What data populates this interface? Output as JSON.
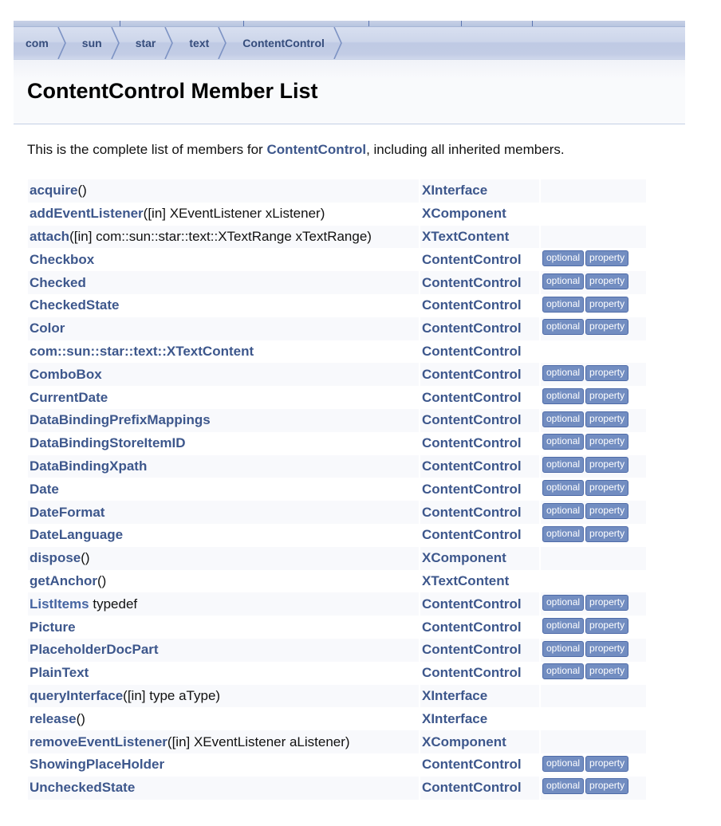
{
  "breadcrumb": [
    "com",
    "sun",
    "star",
    "text",
    "ContentControl"
  ],
  "header": {
    "title": "ContentControl Member List"
  },
  "intro": {
    "before": "This is the complete list of members for ",
    "link": "ContentControl",
    "after": ", including all inherited members."
  },
  "colors": {
    "link": "#3D578C",
    "badge_bg": "#728DC1",
    "stripe": "#F8F9FC"
  },
  "members": [
    {
      "name": "acquire",
      "args": "()",
      "scope": "XInterface",
      "badges": []
    },
    {
      "name": "addEventListener",
      "args": "([in] XEventListener xListener)",
      "scope": "XComponent",
      "badges": []
    },
    {
      "name": "attach",
      "args": "([in] com::sun::star::text::XTextRange xTextRange)",
      "scope": "XTextContent",
      "badges": []
    },
    {
      "name": "Checkbox",
      "args": "",
      "scope": "ContentControl",
      "badges": [
        "optional",
        "property"
      ]
    },
    {
      "name": "Checked",
      "args": "",
      "scope": "ContentControl",
      "badges": [
        "optional",
        "property"
      ]
    },
    {
      "name": "CheckedState",
      "args": "",
      "scope": "ContentControl",
      "badges": [
        "optional",
        "property"
      ]
    },
    {
      "name": "Color",
      "args": "",
      "scope": "ContentControl",
      "badges": [
        "optional",
        "property"
      ]
    },
    {
      "name": "com::sun::star::text::XTextContent",
      "args": "",
      "scope": "ContentControl",
      "badges": []
    },
    {
      "name": "ComboBox",
      "args": "",
      "scope": "ContentControl",
      "badges": [
        "optional",
        "property"
      ]
    },
    {
      "name": "CurrentDate",
      "args": "",
      "scope": "ContentControl",
      "badges": [
        "optional",
        "property"
      ]
    },
    {
      "name": "DataBindingPrefixMappings",
      "args": "",
      "scope": "ContentControl",
      "badges": [
        "optional",
        "property"
      ]
    },
    {
      "name": "DataBindingStoreItemID",
      "args": "",
      "scope": "ContentControl",
      "badges": [
        "optional",
        "property"
      ]
    },
    {
      "name": "DataBindingXpath",
      "args": "",
      "scope": "ContentControl",
      "badges": [
        "optional",
        "property"
      ]
    },
    {
      "name": "Date",
      "args": "",
      "scope": "ContentControl",
      "badges": [
        "optional",
        "property"
      ]
    },
    {
      "name": "DateFormat",
      "args": "",
      "scope": "ContentControl",
      "badges": [
        "optional",
        "property"
      ]
    },
    {
      "name": "DateLanguage",
      "args": "",
      "scope": "ContentControl",
      "badges": [
        "optional",
        "property"
      ]
    },
    {
      "name": "dispose",
      "args": "()",
      "scope": "XComponent",
      "badges": []
    },
    {
      "name": "getAnchor",
      "args": "()",
      "scope": "XTextContent",
      "badges": []
    },
    {
      "name": "ListItems",
      "args": " typedef",
      "scope": "ContentControl",
      "badges": [
        "optional",
        "property"
      ],
      "light": true
    },
    {
      "name": "Picture",
      "args": "",
      "scope": "ContentControl",
      "badges": [
        "optional",
        "property"
      ]
    },
    {
      "name": "PlaceholderDocPart",
      "args": "",
      "scope": "ContentControl",
      "badges": [
        "optional",
        "property"
      ]
    },
    {
      "name": "PlainText",
      "args": "",
      "scope": "ContentControl",
      "badges": [
        "optional",
        "property"
      ]
    },
    {
      "name": "queryInterface",
      "args": "([in] type aType)",
      "scope": "XInterface",
      "badges": []
    },
    {
      "name": "release",
      "args": "()",
      "scope": "XInterface",
      "badges": []
    },
    {
      "name": "removeEventListener",
      "args": "([in] XEventListener aListener)",
      "scope": "XComponent",
      "badges": []
    },
    {
      "name": "ShowingPlaceHolder",
      "args": "",
      "scope": "ContentControl",
      "badges": [
        "optional",
        "property"
      ]
    },
    {
      "name": "UncheckedState",
      "args": "",
      "scope": "ContentControl",
      "badges": [
        "optional",
        "property"
      ]
    }
  ]
}
